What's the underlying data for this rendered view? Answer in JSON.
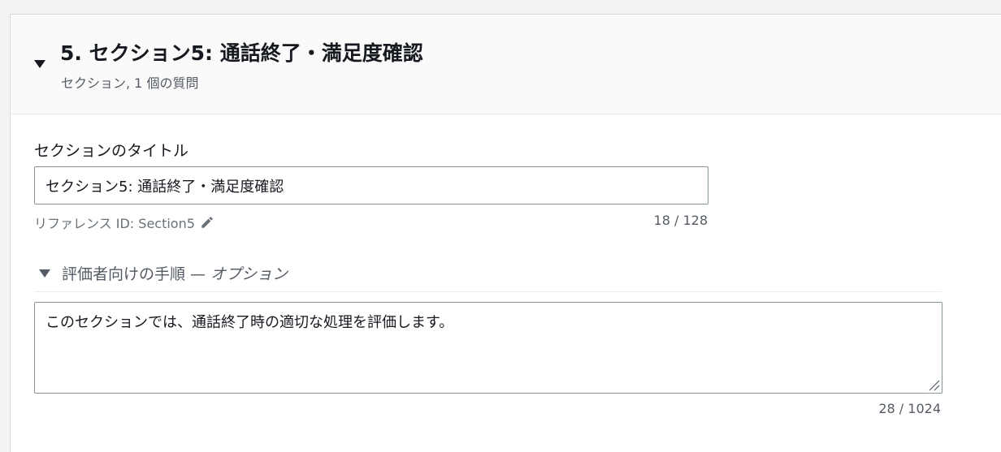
{
  "section": {
    "title": "5. セクション5: 通話終了・満足度確認",
    "subtitle": "セクション, 1 個の質問"
  },
  "title_field": {
    "label": "セクションのタイトル",
    "value": "セクション5: 通話終了・満足度確認",
    "reference_id": "リファレンス ID: Section5",
    "counter": "18 / 128"
  },
  "instructions": {
    "label": "評価者向けの手順 — ",
    "optional": "オプション",
    "value": "このセクションでは、通話終了時の適切な処理を評価します。",
    "counter": "28 / 1024"
  },
  "icons": {
    "header_caret": "caret-down-icon",
    "edit": "pencil-icon",
    "expander_caret": "caret-down-icon",
    "resize": "resize-grip-icon"
  }
}
